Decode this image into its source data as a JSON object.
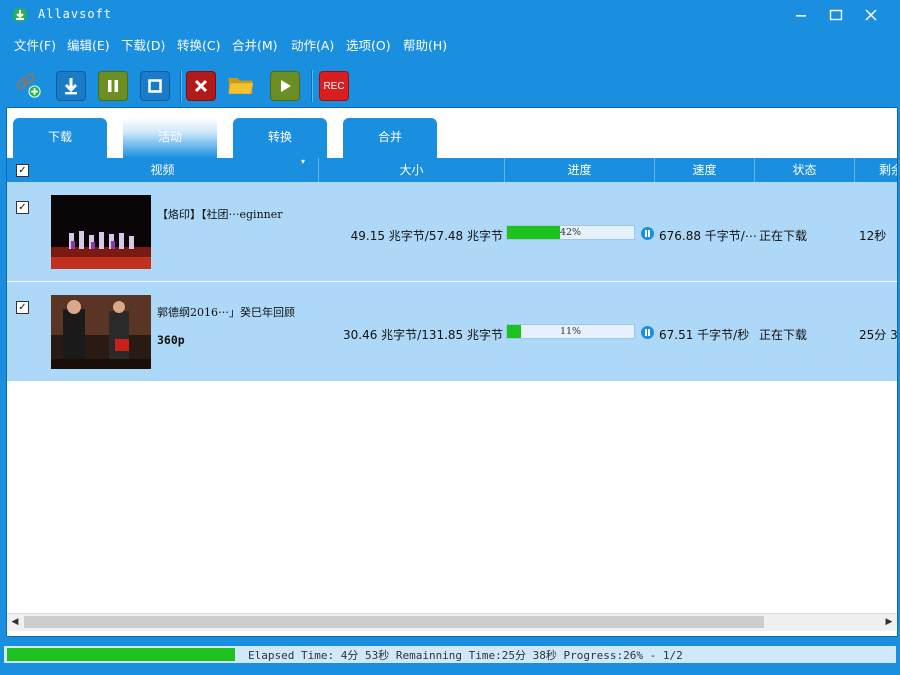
{
  "window": {
    "title": "Allavsoft"
  },
  "menu": [
    "文件(F)",
    "编辑(E)",
    "下载(D)",
    "转换(C)",
    "合并(M)",
    "动作(A)",
    "选项(O)",
    "帮助(H)"
  ],
  "toolbar": {
    "rec_label": "REC",
    "buttons": [
      "link-add-icon",
      "download-icon",
      "pause-icon",
      "stop-icon",
      "delete-icon",
      "folder-icon",
      "play-icon",
      "rec-icon"
    ]
  },
  "tabs": [
    {
      "label": "下载",
      "active": false
    },
    {
      "label": "活动",
      "active": true
    },
    {
      "label": "转换",
      "active": false
    },
    {
      "label": "合并",
      "active": false
    }
  ],
  "columns": {
    "video": "视频",
    "size": "大小",
    "progress": "进度",
    "speed": "速度",
    "status": "状态",
    "remaining": "剩余"
  },
  "rows": [
    {
      "checked": true,
      "title": "【烙印】【社团⋯eginner",
      "resolution": "",
      "size": "49.15 兆字节/57.48 兆字节",
      "progress_percent": 42,
      "progress_label": "42%",
      "speed": "676.88 千字节/⋯",
      "status": "正在下载",
      "remaining": "12秒"
    },
    {
      "checked": true,
      "title": "郭德纲2016⋯」癸巳年回顾",
      "resolution": "360p",
      "size": "30.46 兆字节/131.85 兆字节",
      "progress_percent": 11,
      "progress_label": "11%",
      "speed": "67.51 千字节/秒",
      "status": "正在下载",
      "remaining": "25分 3"
    }
  ],
  "statusbar": {
    "progress_percent": 26,
    "text": "Elapsed Time: 4分 53秒 Remainning Time:25分 38秒 Progress:26% - 1/2"
  },
  "colors": {
    "accent": "#1a8fe0",
    "row_bg": "#aed8f8",
    "progress_green": "#1ec21e"
  }
}
